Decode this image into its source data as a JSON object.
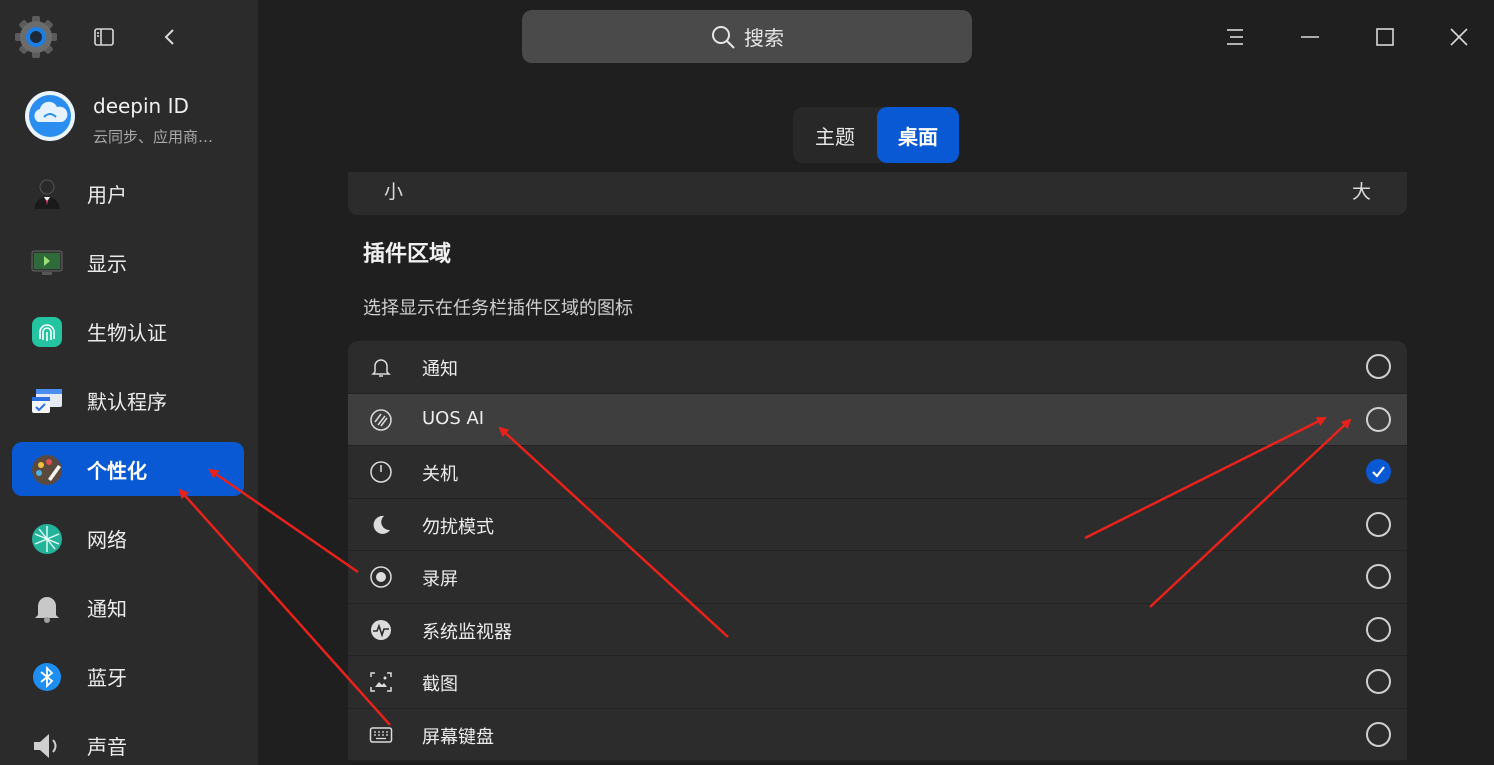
{
  "header": {
    "search_placeholder": "搜索"
  },
  "account": {
    "name": "deepin ID",
    "subtitle": "云同步、应用商…"
  },
  "sidebar": {
    "items": [
      {
        "label": "用户",
        "icon": "user-icon"
      },
      {
        "label": "显示",
        "icon": "display-icon"
      },
      {
        "label": "生物认证",
        "icon": "fingerprint-icon"
      },
      {
        "label": "默认程序",
        "icon": "default-apps-icon"
      },
      {
        "label": "个性化",
        "icon": "personalization-icon",
        "active": true
      },
      {
        "label": "网络",
        "icon": "network-icon"
      },
      {
        "label": "通知",
        "icon": "notification-bell-icon"
      },
      {
        "label": "蓝牙",
        "icon": "bluetooth-icon"
      },
      {
        "label": "声音",
        "icon": "sound-icon"
      }
    ]
  },
  "tabs": [
    {
      "label": "主题",
      "selected": false
    },
    {
      "label": "桌面",
      "selected": true
    }
  ],
  "size_slider": {
    "min_label": "小",
    "max_label": "大"
  },
  "plugin_area": {
    "title": "插件区域",
    "description": "选择显示在任务栏插件区域的图标",
    "items": [
      {
        "label": "通知",
        "icon": "bell-icon",
        "checked": false
      },
      {
        "label": "UOS AI",
        "icon": "uos-ai-icon",
        "checked": false
      },
      {
        "label": "关机",
        "icon": "power-icon",
        "checked": true
      },
      {
        "label": "勿扰模式",
        "icon": "moon-icon",
        "checked": false
      },
      {
        "label": "录屏",
        "icon": "record-icon",
        "checked": false
      },
      {
        "label": "系统监视器",
        "icon": "system-monitor-icon",
        "checked": false
      },
      {
        "label": "截图",
        "icon": "screenshot-icon",
        "checked": false
      },
      {
        "label": "屏幕键盘",
        "icon": "keyboard-icon",
        "checked": false
      }
    ]
  },
  "colors": {
    "accent": "#0a59d4",
    "annotation_arrow": "#e8221b"
  }
}
